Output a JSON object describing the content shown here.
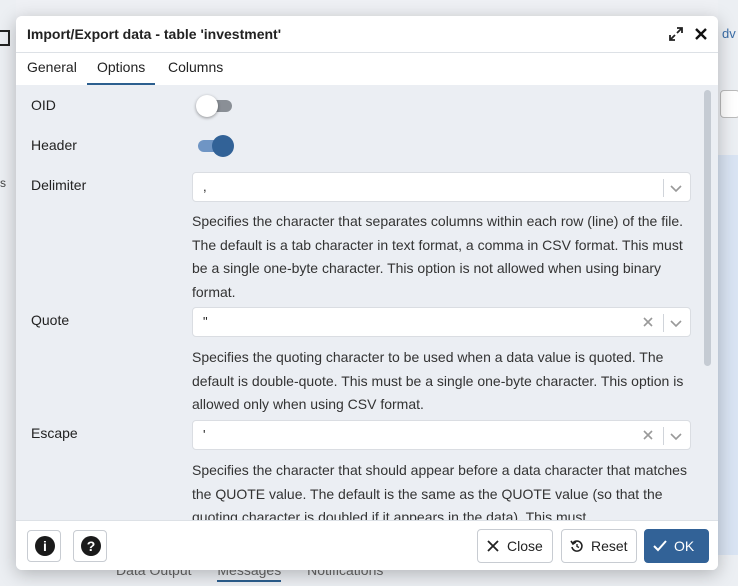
{
  "background": {
    "right_tab_label": "dv",
    "left_text": "s",
    "bottom_tabs": [
      "Data Output",
      "Messages",
      "Notifications"
    ]
  },
  "dialog": {
    "title": "Import/Export data - table 'investment'",
    "tabs": [
      {
        "label": "General",
        "active": false
      },
      {
        "label": "Options",
        "active": true
      },
      {
        "label": "Columns",
        "active": false
      }
    ],
    "fields": {
      "oid": {
        "label": "OID",
        "enabled": false
      },
      "header": {
        "label": "Header",
        "enabled": true
      },
      "delimiter": {
        "label": "Delimiter",
        "value": ",",
        "help": "Specifies the character that separates columns within each row (line) of the file. The default is a tab character in text format, a comma in CSV format. This must be a single one-byte character. This option is not allowed when using binary format."
      },
      "quote": {
        "label": "Quote",
        "value": "\"",
        "help": "Specifies the quoting character to be used when a data value is quoted. The default is double-quote. This must be a single one-byte character. This option is allowed only when using CSV format."
      },
      "escape": {
        "label": "Escape",
        "value": "'",
        "help": "Specifies the character that should appear before a data character that matches the QUOTE value. The default is the same as the QUOTE value (so that the quoting character is doubled if it appears in the data). This must"
      }
    },
    "footer": {
      "info_icon": "info-icon",
      "help_icon": "help-icon",
      "close_label": "Close",
      "reset_label": "Reset",
      "ok_label": "OK"
    },
    "colors": {
      "accent": "#326297",
      "content_bg": "#ebeef3"
    }
  }
}
